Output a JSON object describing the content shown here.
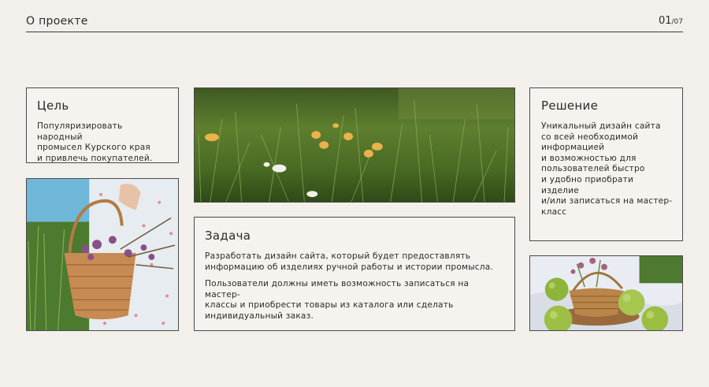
{
  "header": {
    "title": "О проекте",
    "page_current": "01",
    "page_total": "/07"
  },
  "goal": {
    "title": "Цель",
    "lines": [
      "Популяризировать народный",
      "промысел Курского края",
      "и привлечь покупателей."
    ]
  },
  "solution": {
    "title": "Решение",
    "lines": [
      "Уникальный дизайн сайта",
      "со всей необходимой",
      "информацией",
      "и возможностью для",
      "пользователей быстро",
      "и удобно приобрати изделие",
      "и/или записаться на мастер-",
      "класс"
    ]
  },
  "task": {
    "title": "Задача",
    "paragraph1": [
      "Разработать дизайн сайта, который будет предоставлять",
      "информацию об изделиях ручной работы и истории промысла."
    ],
    "paragraph2": [
      "Пользователи должны иметь возможность записаться на мастер-",
      "классы и приобрести товары из каталога или сделать",
      "индивидуальный заказ."
    ]
  },
  "colors": {
    "background": "#f3f0ec",
    "border": "#4a4a4a",
    "text": "#2b2b2b"
  }
}
